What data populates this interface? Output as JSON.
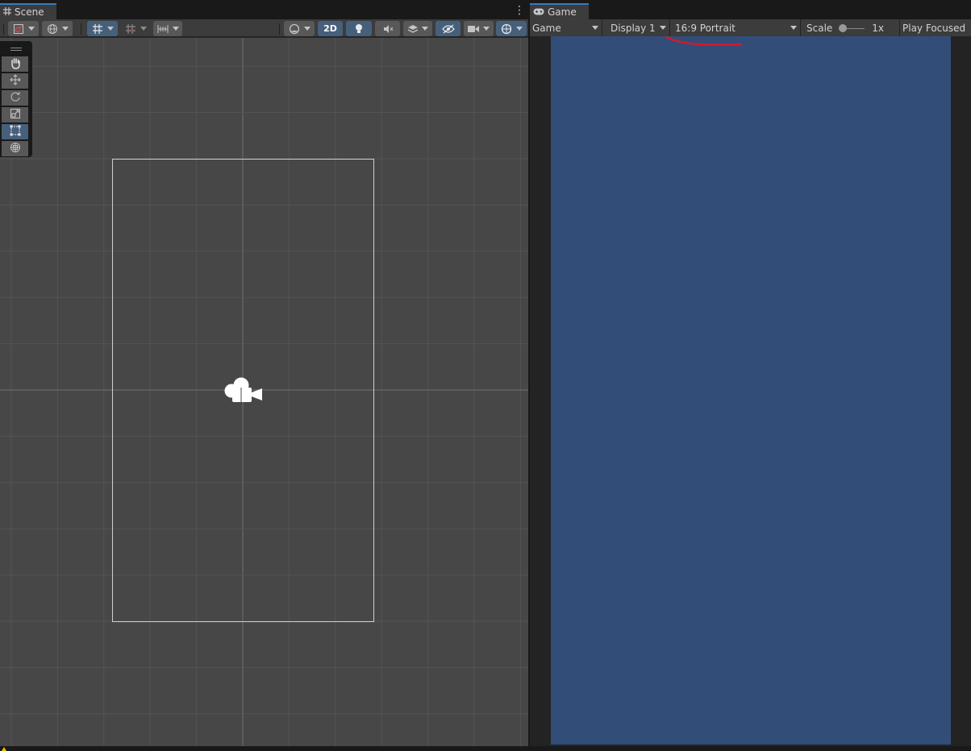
{
  "scene": {
    "tab_label": "Scene",
    "toolbar": {
      "mode_2d_label": "2D"
    }
  },
  "game": {
    "tab_label": "Game",
    "toolbar": {
      "view_mode": "Game",
      "display": "Display 1",
      "aspect": "16:9 Portrait",
      "scale_label": "Scale",
      "scale_value": "1x",
      "play_mode": "Play Focused"
    }
  },
  "icons": {
    "scene_tab": "grid-hash-icon",
    "game_tab": "gamepad-icon",
    "tools": [
      "hand-tool-icon",
      "move-tool-icon",
      "rotate-tool-icon",
      "scale-tool-icon",
      "rect-tool-icon",
      "transform-tool-icon"
    ],
    "camera": "camera-gizmo-icon"
  },
  "colors": {
    "accent": "#3a79bb",
    "active_button": "#46607c",
    "game_background": "#324e78",
    "scene_background": "#474747",
    "annotation": "#e0142a"
  }
}
